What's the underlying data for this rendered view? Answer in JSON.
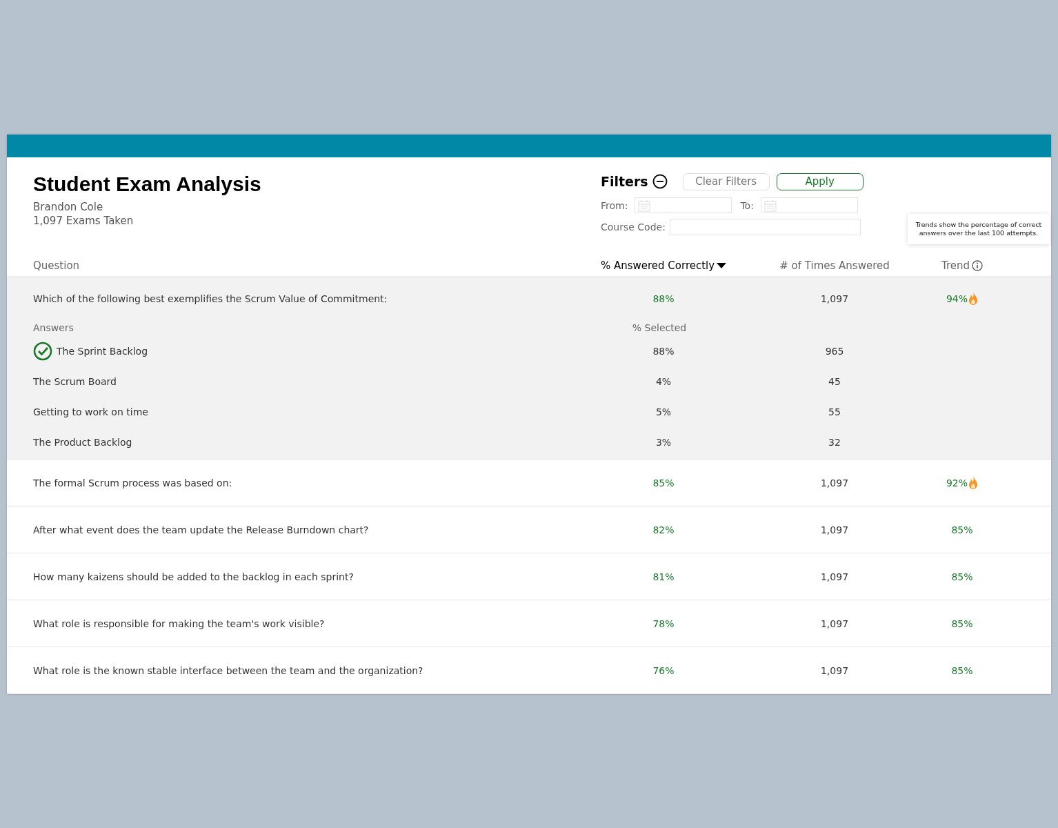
{
  "title": "Student Exam Analysis",
  "student": "Brandon Cole",
  "exams_taken": "1,097 Exams Taken",
  "filters": {
    "label": "Filters",
    "expanded": true,
    "clear_button": "Clear Filters",
    "apply_button": "Apply",
    "from_label": "From:",
    "to_label": "To:",
    "course_code_label": "Course Code:"
  },
  "tooltip": "Trends show the percentage of correct answers over the last 100 attempts.",
  "columns": [
    {
      "label": "Question",
      "sorted": false
    },
    {
      "label": "% Answered Correctly",
      "sorted": true
    },
    {
      "label": "# of Times Answered",
      "sorted": false
    },
    {
      "label": "Trend",
      "sorted": false
    }
  ],
  "answers_header": {
    "label": "Answers",
    "selected_label": "% Selected"
  },
  "questions": [
    {
      "question": "Which of the following best exemplifies the Scrum Value of Commitment:",
      "correct": "88%",
      "times": "1,097",
      "trend": "94%",
      "hot": true,
      "expanded": true,
      "answers": [
        {
          "text": "The Sprint Backlog",
          "correct": true,
          "selected_pct": "88%",
          "count": "965"
        },
        {
          "text": "The Scrum Board",
          "correct": false,
          "selected_pct": "4%",
          "count": "45"
        },
        {
          "text": "Getting to work on time",
          "correct": false,
          "selected_pct": "5%",
          "count": "55"
        },
        {
          "text": "The Product Backlog",
          "correct": false,
          "selected_pct": "3%",
          "count": "32"
        }
      ]
    },
    {
      "question": "The formal Scrum process was based on:",
      "correct": "85%",
      "times": "1,097",
      "trend": "92%",
      "hot": true,
      "expanded": false
    },
    {
      "question": "After what event does the team update the Release Burndown chart?",
      "correct": "82%",
      "times": "1,097",
      "trend": "85%",
      "hot": false,
      "expanded": false
    },
    {
      "question": "How many kaizens should be added to the backlog in each sprint?",
      "correct": "81%",
      "times": "1,097",
      "trend": "85%",
      "hot": false,
      "expanded": false
    },
    {
      "question": "What role is responsible for making the team's work visible?",
      "correct": "78%",
      "times": "1,097",
      "trend": "85%",
      "hot": false,
      "expanded": false
    },
    {
      "question": "What role is the known stable interface between the team and the organization?",
      "correct": "76%",
      "times": "1,097",
      "trend": "85%",
      "hot": false,
      "expanded": false
    }
  ]
}
